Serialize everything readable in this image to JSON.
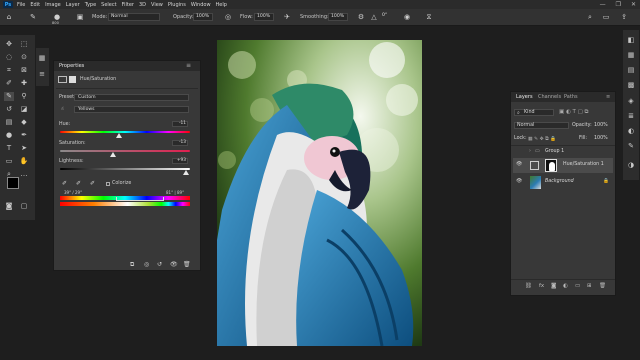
{
  "app": {
    "logo": "Ps"
  },
  "menu": [
    "File",
    "Edit",
    "Image",
    "Layer",
    "Type",
    "Select",
    "Filter",
    "3D",
    "View",
    "Plugins",
    "Window",
    "Help"
  ],
  "window_controls": {
    "minimize": "—",
    "restore": "❐",
    "close": "✕"
  },
  "options_bar": {
    "brush_size": "800",
    "mode_label": "Mode:",
    "mode_value": "Normal",
    "opacity_label": "Opacity:",
    "opacity_value": "100%",
    "flow_label": "Flow:",
    "flow_value": "100%",
    "smoothing_label": "Smoothing:",
    "smoothing_value": "100%",
    "angle_value": "0°"
  },
  "properties": {
    "title": "Properties",
    "adjustment_name": "Hue/Saturation",
    "preset_label": "Preset:",
    "preset_value": "Custom",
    "channel_value": "Yellows",
    "hue_label": "Hue:",
    "hue_value": "-11",
    "hue_level": 0.45,
    "saturation_label": "Saturation:",
    "saturation_value": "-13",
    "saturation_level": 0.41,
    "lightness_label": "Lightness:",
    "lightness_value": "+93",
    "lightness_level": 0.97,
    "colorize_label": "Colorize",
    "range_left": "39° / 29°",
    "range_right": "81° | 89°"
  },
  "layers": {
    "tabs": [
      "Layers",
      "Channels",
      "Paths"
    ],
    "kind_label": "Kind",
    "blend_mode": "Normal",
    "opacity_label": "Opacity:",
    "opacity_value": "100%",
    "lock_label": "Lock:",
    "fill_label": "Fill:",
    "fill_value": "100%",
    "items": [
      {
        "name": "Group 1"
      },
      {
        "name": "Hue/Saturation 1"
      },
      {
        "name": "Background"
      }
    ]
  },
  "colors": {
    "accent": "#31a8ff",
    "panel": "#383838",
    "bg": "#1e1e1e"
  }
}
